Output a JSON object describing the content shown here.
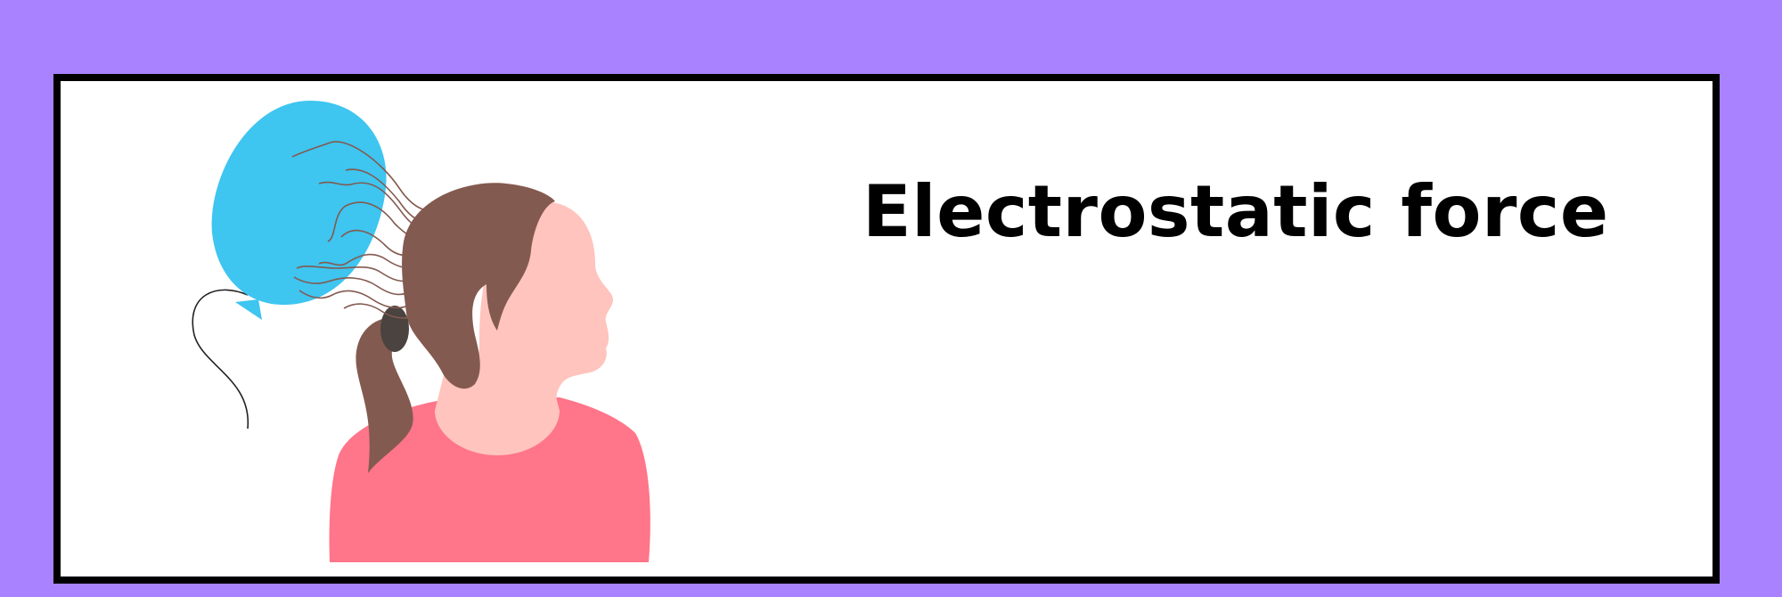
{
  "slide": {
    "title": "Electrostatic force"
  },
  "illustration": {
    "description_icon": "balloon-attracting-hair-icon"
  },
  "colors": {
    "page_background": "#a882ff",
    "frame_border": "#000000",
    "panel_background": "#ffffff",
    "balloon": "#3ec5f0",
    "hair": "#835a50",
    "hair_tie": "#4a433f",
    "skin": "#ffc4bd",
    "shirt": "#ff7589",
    "title_text": "#000000"
  }
}
